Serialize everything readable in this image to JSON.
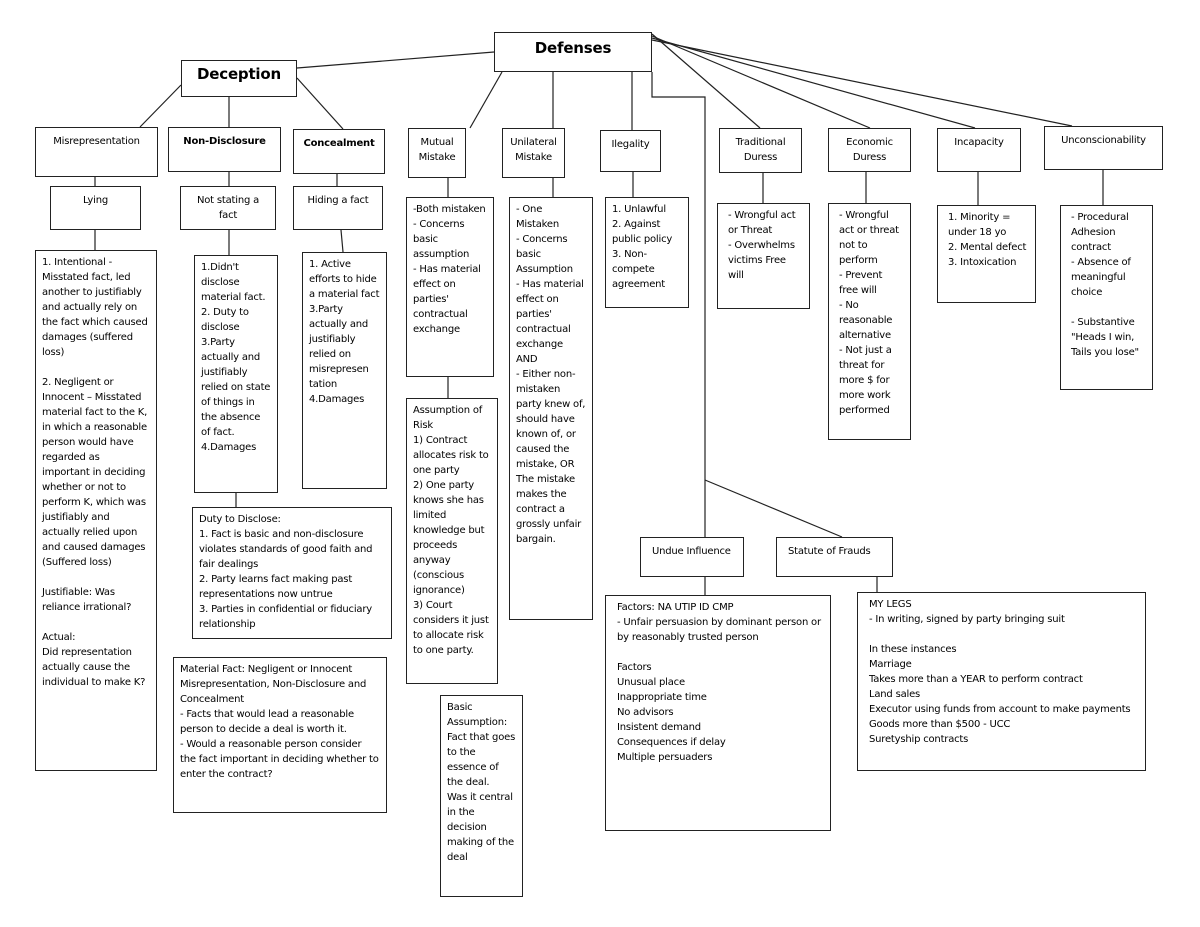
{
  "root": "Defenses",
  "deception": {
    "title": "Deception",
    "misrepresentation": {
      "title": "Misrepresentation",
      "sub": "Lying",
      "detail": "1. Intentional - Misstated fact, led another to justifiably and actually rely on the fact which caused damages (suffered loss)\n\n2. Negligent or Innocent – Misstated material fact to the K, in which a reasonable person would have regarded as important in deciding whether or not to perform K, which was justifiably and actually relied upon and caused damages (Suffered loss)\n\nJustifiable: Was reliance irrational?\n\nActual:\nDid representation actually cause the individual to make K?"
    },
    "non_disclosure": {
      "title": "Non-Disclosure",
      "sub": "Not stating a fact",
      "detail": "1.Didn't disclose material fact.\n2. Duty to disclose\n3.Party actually and justifiably relied on state of things in the absence of fact.\n4.Damages",
      "duty": "Duty to Disclose:\n1. Fact is basic and non-disclosure violates standards of good faith and fair dealings\n2. Party learns fact making past representations now untrue\n3. Parties in confidential or fiduciary relationship"
    },
    "concealment": {
      "title": "Concealment",
      "sub": "Hiding a fact",
      "detail": "1. Active efforts to hide a material fact\n3.Party actually and justifiably relied on misrepresen tation\n4.Damages"
    },
    "material_fact": "Material Fact: Negligent or Innocent Misrepresentation, Non-Disclosure and Concealment\n- Facts that would lead a reasonable person to decide a deal is worth it.\n- Would a reasonable person consider the fact important in deciding whether to enter the contract?"
  },
  "mutual_mistake": {
    "title": "Mutual\nMistake",
    "detail": "-Both mistaken\n- Concerns basic assumption\n- Has material effect on parties' contractual exchange",
    "risk": "Assumption of Risk\n1) Contract allocates risk to one party\n2) One party knows she has limited knowledge but proceeds anyway (conscious ignorance)\n3) Court considers it just to allocate risk to one party.",
    "basic": "Basic Assumption:\nFact that goes to the essence of the deal.\nWas it central in the decision making of the deal"
  },
  "unilateral_mistake": {
    "title": "Unilateral\nMistake",
    "detail": "- One Mistaken\n- Concerns basic Assumption\n- Has material effect on parties' contractual exchange\nAND\n- Either non-mistaken party knew of, should have known of, or caused the mistake, OR The mistake makes the contract a grossly unfair bargain."
  },
  "illegality": {
    "title": "Ilegality",
    "detail": "1. Unlawful\n2. Against public policy\n3. Non-compete agreement"
  },
  "traditional_duress": {
    "title": "Traditional\nDuress",
    "detail": "- Wrongful act or Threat\n- Overwhelms victims Free will"
  },
  "economic_duress": {
    "title": "Economic\nDuress",
    "detail": "- Wrongful act or threat not to perform\n- Prevent free will\n- No reasonable alternative\n- Not just a threat for more $ for more work performed"
  },
  "incapacity": {
    "title": "Incapacity",
    "detail": "1. Minority = under 18 yo\n2. Mental defect\n3. Intoxication"
  },
  "unconscionability": {
    "title": "Unconscionability",
    "detail": "- Procedural Adhesion contract\n- Absence of meaningful choice\n\n- Substantive \"Heads I win, Tails you lose\""
  },
  "undue_influence": {
    "title": "Undue Influence",
    "detail": "Factors: NA UTIP ID CMP\n- Unfair persuasion by dominant person or by reasonably trusted person\n\nFactors\nUnusual place\nInappropriate time\nNo advisors\nInsistent demand\nConsequences if delay\nMultiple persuaders"
  },
  "statute_of_frauds": {
    "title": "Statute of Frauds",
    "detail": "MY LEGS\n- In writing, signed by party bringing suit\n\nIn these instances\nMarriage\nTakes more than a YEAR to perform contract\nLand sales\nExecutor using funds from account to make payments\nGoods more than $500 - UCC\nSuretyship contracts"
  }
}
